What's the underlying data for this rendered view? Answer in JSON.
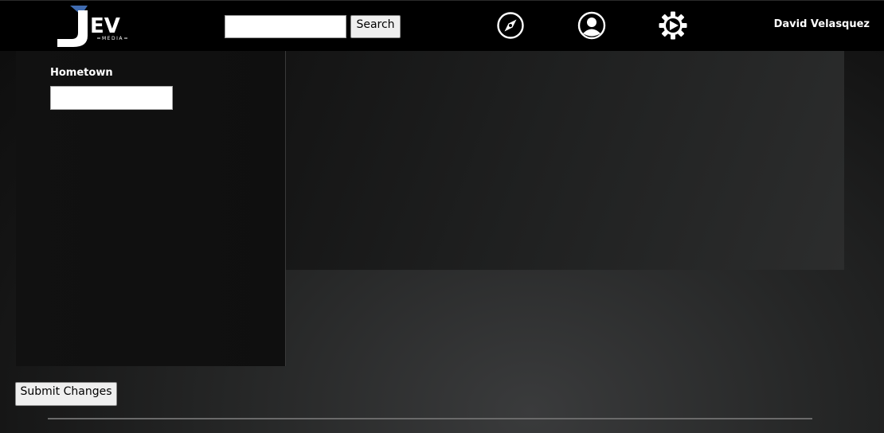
{
  "header": {
    "logo": {
      "letters": "EV",
      "tagline": "MEDIA",
      "accent_color": "#3f6bb0"
    },
    "search": {
      "placeholder": "",
      "button_label": "Search"
    },
    "nav_icons": [
      "compass-icon",
      "profile-icon",
      "gear-icon"
    ],
    "username": "David Velasquez"
  },
  "form": {
    "hometown_label": "Hometown",
    "hometown_value": "",
    "submit_label": "Submit Changes"
  }
}
